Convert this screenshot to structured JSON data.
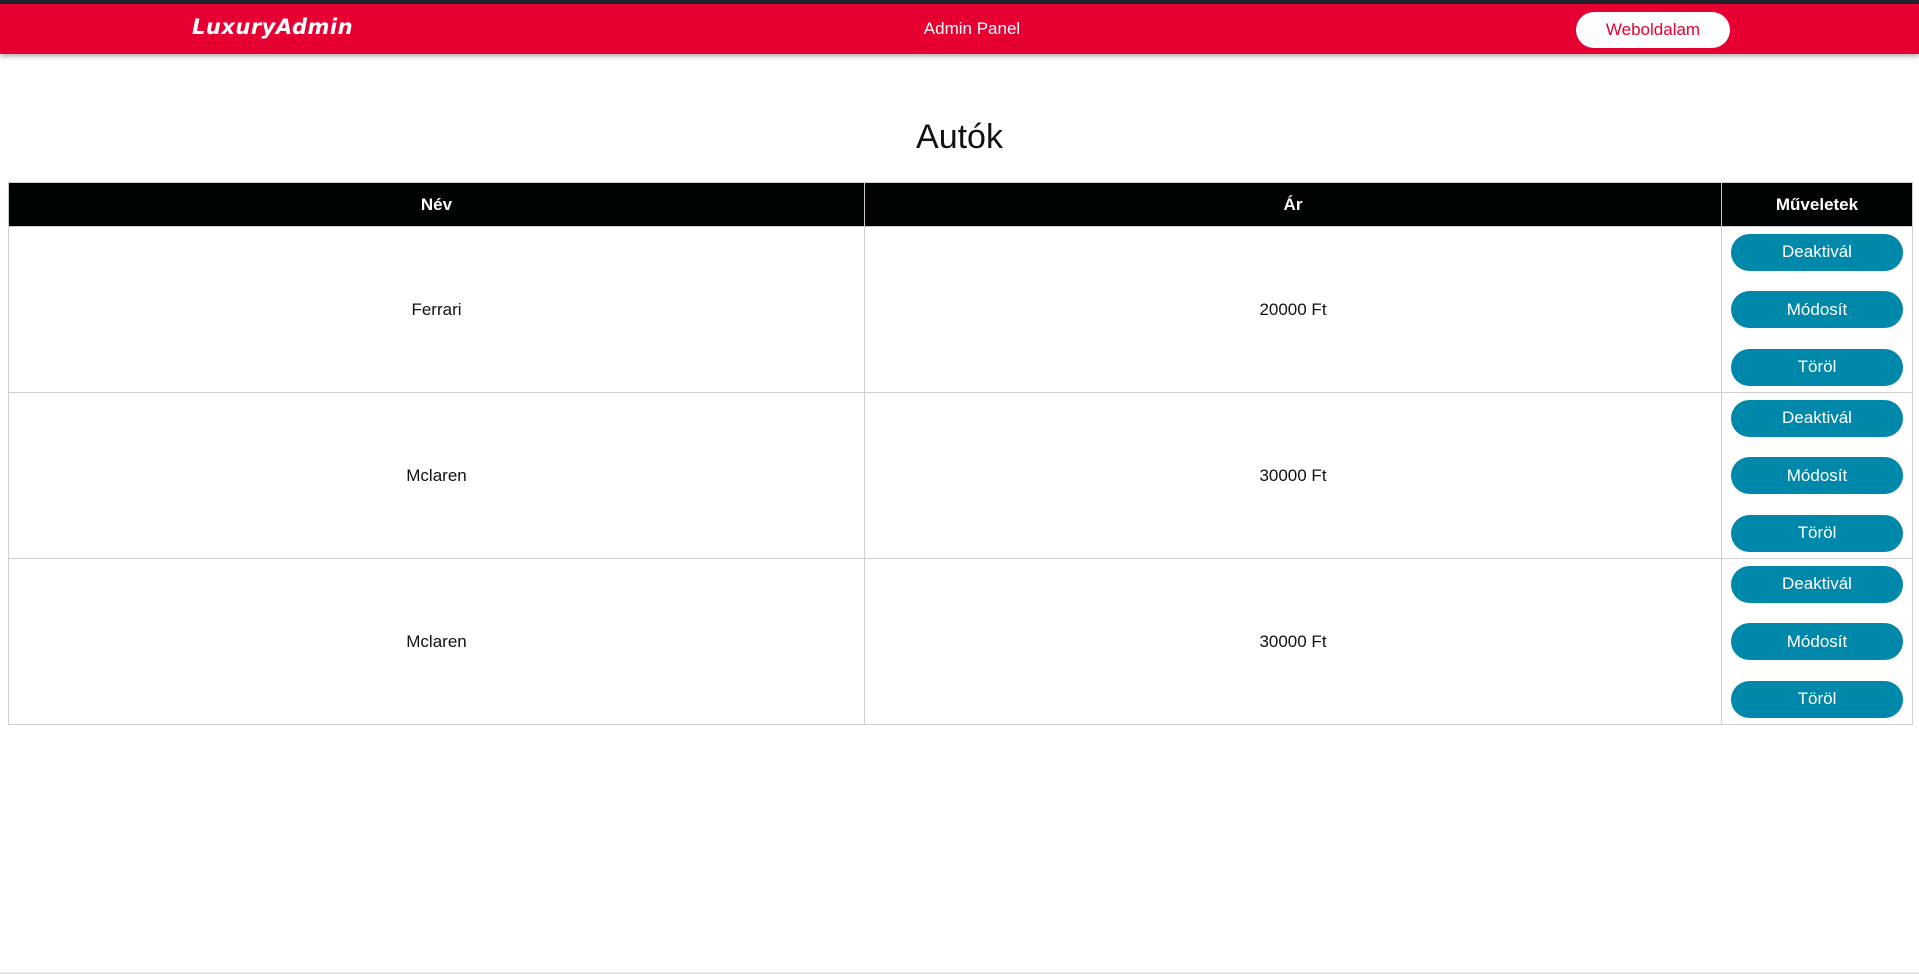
{
  "navbar": {
    "brand": "LuxuryAdmin",
    "title": "Admin Panel",
    "site_button": "Weboldalam",
    "color": "#e60032"
  },
  "page": {
    "title": "Autók"
  },
  "table": {
    "headers": [
      "Név",
      "Ár",
      "Műveletek"
    ],
    "rows": [
      {
        "name": "Ferrari",
        "price": "20000 Ft",
        "actions": [
          "Deaktivál",
          "Módosít",
          "Töröl"
        ]
      },
      {
        "name": "Mclaren",
        "price": "30000 Ft",
        "actions": [
          "Deaktivál",
          "Módosít",
          "Töröl"
        ]
      },
      {
        "name": "Mclaren",
        "price": "30000 Ft",
        "actions": [
          "Deaktivál",
          "Módosít",
          "Töröl"
        ]
      }
    ]
  },
  "colors": {
    "header_bg": "#000402",
    "action_button": "#0088ab"
  }
}
